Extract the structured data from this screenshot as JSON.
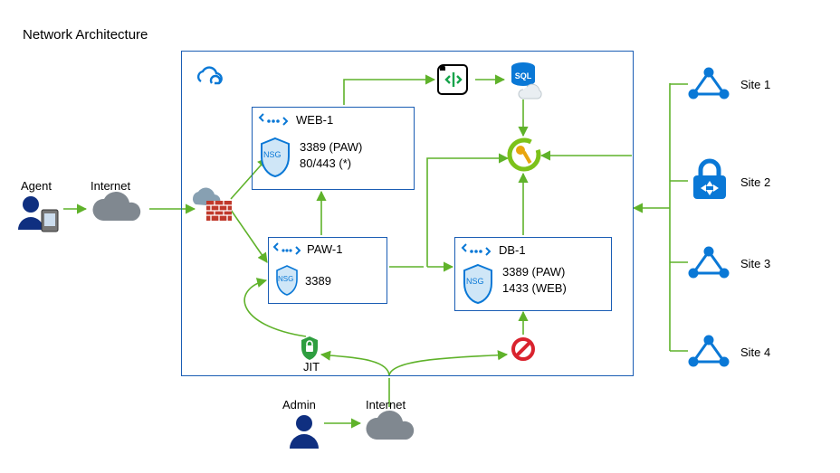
{
  "title": "Network Architecture",
  "external_left": {
    "agent_label": "Agent",
    "internet_label": "Internet"
  },
  "bottom": {
    "admin_label": "Admin",
    "internet_label": "Internet",
    "jit_label": "JIT"
  },
  "boxes": {
    "web1": {
      "name": "WEB-1",
      "nsg_badge": "NSG",
      "rule1": "3389 (PAW)",
      "rule2": "80/443 (*)"
    },
    "paw1": {
      "name": "PAW-1",
      "nsg_badge": "NSG",
      "rule1": "3389"
    },
    "db1": {
      "name": "DB-1",
      "nsg_badge": "NSG",
      "rule1": "3389 (PAW)",
      "rule2": "1433 (WEB)"
    }
  },
  "sites": {
    "s1": "Site 1",
    "s2": "Site 2",
    "s3": "Site 3",
    "s4": "Site 4"
  },
  "icons": {
    "cloud_logo": "azure-cloud",
    "sql": "SQL",
    "script": "script",
    "key": "key",
    "firewall": "firewall",
    "jit_lock": "lock",
    "deny": "deny",
    "user": "user",
    "internet": "internet-cloud",
    "site_node": "site-node",
    "vpn_lock": "vpn-gateway"
  }
}
